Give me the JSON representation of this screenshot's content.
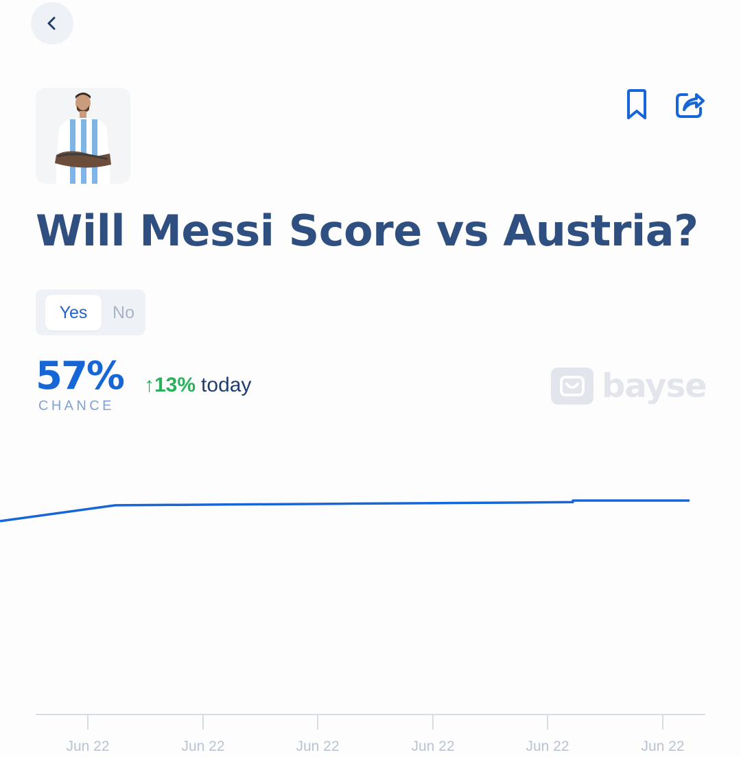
{
  "header": {
    "back_icon": "chevron-left-icon",
    "bookmark_icon": "bookmark-icon",
    "share_icon": "share-icon"
  },
  "market": {
    "title": "Will Messi Score vs Austria?",
    "avatar": "player-photo"
  },
  "outcome_toggle": {
    "options": [
      "Yes",
      "No"
    ],
    "selected": "Yes"
  },
  "stats": {
    "chance_value": "57%",
    "chance_label": "CHANCE",
    "change_arrow": "↑",
    "change_value": "13%",
    "change_period": "today"
  },
  "brand": {
    "watermark_text": "bayse"
  },
  "colors": {
    "accent": "#1666d8",
    "positive": "#29b05a",
    "title": "#2f4f80"
  },
  "chart_data": {
    "type": "line",
    "x_tick_labels": [
      "Jun 22",
      "Jun 22",
      "Jun 22",
      "Jun 22",
      "Jun 22",
      "Jun 22"
    ],
    "series": [
      {
        "values": [
          44,
          54,
          54.5,
          55,
          55.5,
          56,
          57,
          57,
          57
        ]
      }
    ],
    "ylim": [
      0,
      100
    ],
    "grid": false
  }
}
